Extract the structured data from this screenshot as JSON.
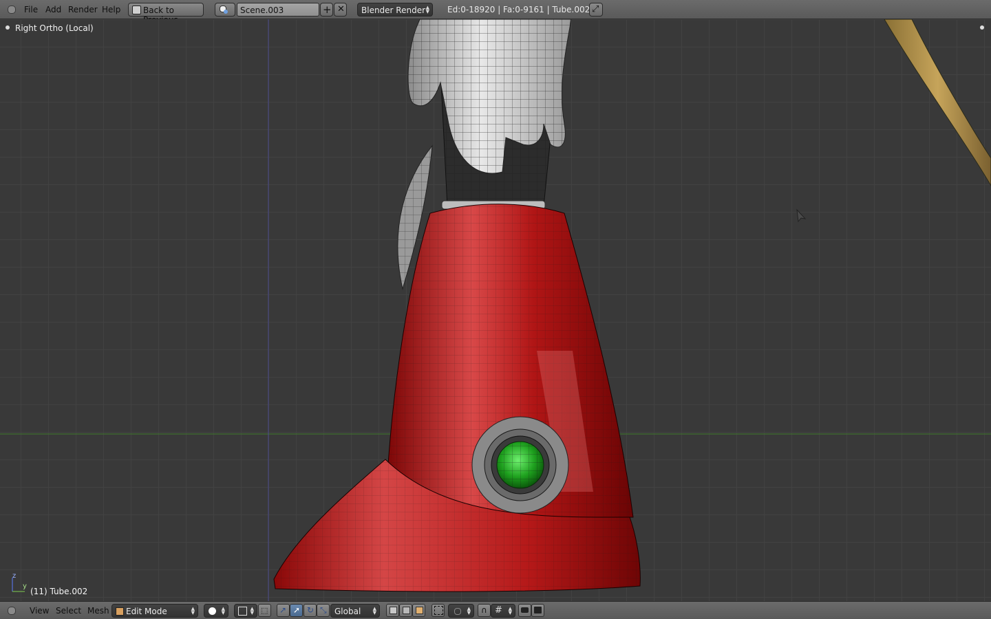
{
  "menu": {
    "file": "File",
    "add": "Add",
    "render": "Render",
    "help": "Help"
  },
  "back_button": "Back to Previous",
  "scene": {
    "name": "Scene.003"
  },
  "render_engine": "Blender Render",
  "stats": "Ed:0-18920 | Fa:0-9161 | Tube.002",
  "viewport": {
    "label": "Right Ortho (Local)",
    "object_label": "(11) Tube.002",
    "axis_z": "z",
    "axis_y": "y"
  },
  "bottom": {
    "view": "View",
    "select": "Select",
    "mesh": "Mesh",
    "mode": "Edit Mode",
    "orientation": "Global"
  },
  "colors": {
    "header": "#5f5f5f",
    "viewport": "#393939",
    "grid": "#424242",
    "x_axis": "#3e7a2a",
    "z_axis": "#4a4a8c",
    "body": "#c01010",
    "lens": "#20a020"
  }
}
